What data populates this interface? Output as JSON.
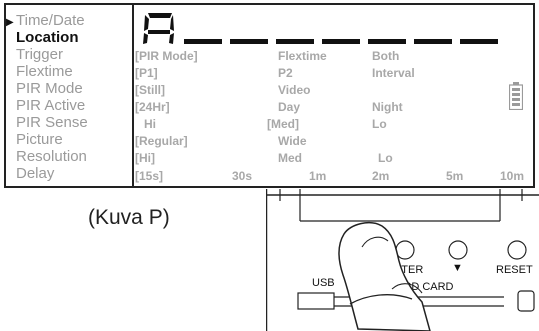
{
  "menu": {
    "items": [
      {
        "label": "Time/Date",
        "state": "current"
      },
      {
        "label": "Location",
        "state": "active"
      },
      {
        "label": "Trigger",
        "state": "normal"
      },
      {
        "label": "Flextime",
        "state": "normal"
      },
      {
        "label": "PIR Mode",
        "state": "normal"
      },
      {
        "label": "PIR Active",
        "state": "normal"
      },
      {
        "label": "PIR Sense",
        "state": "normal"
      },
      {
        "label": "Picture",
        "state": "normal"
      },
      {
        "label": "Resolution",
        "state": "normal"
      },
      {
        "label": "Delay",
        "state": "normal"
      }
    ]
  },
  "lcd": {
    "digit": "A",
    "rows": {
      "trigger": [
        "[PIR Mode]",
        "Flextime",
        "Both"
      ],
      "flextime": [
        "[P1]",
        "P2",
        "Interval"
      ],
      "pir_mode": [
        "[Still]",
        "Video"
      ],
      "pir_active": [
        "[24Hr]",
        "Day",
        "Night"
      ],
      "pir_sense": [
        "Hi",
        "[Med]",
        "Lo"
      ],
      "picture": [
        "[Regular]",
        "Wide"
      ],
      "resolution": [
        "[Hi]",
        "Med",
        "Lo"
      ],
      "delay": [
        "[15s]",
        "30s",
        "1m",
        "2m",
        "5m",
        "10m"
      ]
    },
    "battery_icon": "battery-icon"
  },
  "caption": "(Kuva P)",
  "device": {
    "labels": {
      "usb": "USB",
      "enter": "ENTER",
      "down": "▼",
      "reset": "RESET",
      "sdcard": "SD CARD"
    }
  }
}
